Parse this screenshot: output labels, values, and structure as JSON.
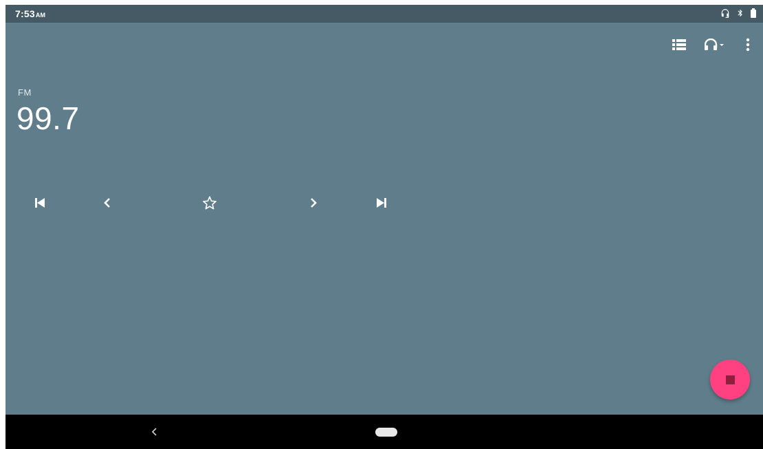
{
  "status_bar": {
    "time": "7:53",
    "ampm": "AM",
    "icons": [
      "headset-icon",
      "bluetooth-icon",
      "battery-icon"
    ]
  },
  "toolbar": {
    "icons": [
      "station-list-icon",
      "headphones-audio-output-icon",
      "overflow-menu-icon"
    ]
  },
  "radio": {
    "band": "FM",
    "frequency": "99.7"
  },
  "controls": {
    "icons": [
      "seek-previous-icon",
      "tune-down-icon",
      "favorite-star-icon",
      "tune-up-icon",
      "seek-next-icon"
    ]
  },
  "fab": {
    "icon": "stop-icon",
    "color": "#ff4081"
  },
  "nav_bar": {
    "icons": [
      "back-icon",
      "home-pill"
    ]
  },
  "colors": {
    "background": "#607d8b",
    "status_bar": "#455a64",
    "accent": "#ff4081",
    "nav_bar": "#000000"
  }
}
